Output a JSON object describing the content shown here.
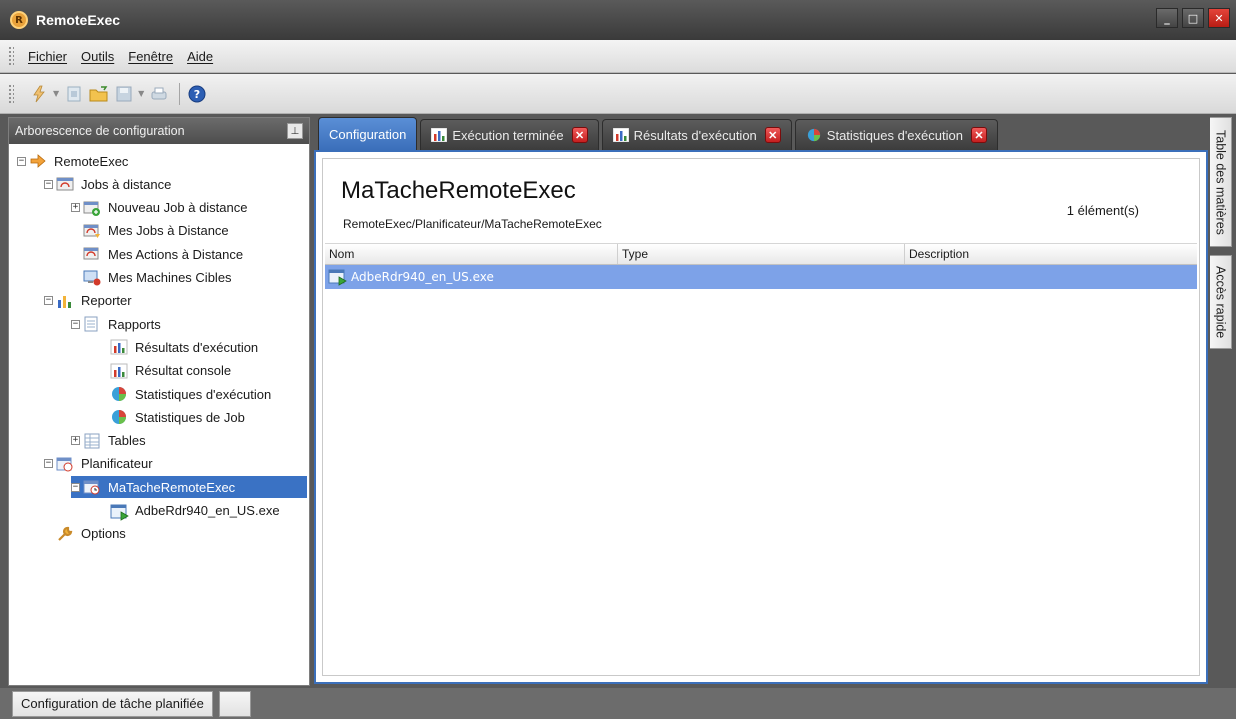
{
  "window": {
    "title": "RemoteExec"
  },
  "menu": [
    "Fichier",
    "Outils",
    "Fenêtre",
    "Aide"
  ],
  "toolbar": {
    "icons": [
      "run-icon",
      "new-icon",
      "open-folder-icon",
      "save-icon",
      "print-icon",
      "help-icon"
    ]
  },
  "left_panel": {
    "header": "Arborescence de configuration",
    "tree": [
      {
        "label": "RemoteExec",
        "icon": "remoteexec-icon",
        "level": 0,
        "expander": "−"
      },
      {
        "label": "Jobs à distance",
        "icon": "jobs-icon",
        "level": 1,
        "expander": "−"
      },
      {
        "label": "Nouveau Job à distance",
        "icon": "new-job-icon",
        "level": 2,
        "expander": "+"
      },
      {
        "label": "Mes Jobs à Distance",
        "icon": "my-jobs-icon",
        "level": 2,
        "expander": ""
      },
      {
        "label": "Mes Actions à Distance",
        "icon": "my-actions-icon",
        "level": 2,
        "expander": ""
      },
      {
        "label": "Mes Machines Cibles",
        "icon": "target-machines-icon",
        "level": 2,
        "expander": ""
      },
      {
        "label": "Reporter",
        "icon": "reporter-icon",
        "level": 1,
        "expander": "−"
      },
      {
        "label": "Rapports",
        "icon": "reports-icon",
        "level": 2,
        "expander": "−"
      },
      {
        "label": "Résultats d'exécution",
        "icon": "bar-chart-icon",
        "level": 3,
        "expander": ""
      },
      {
        "label": "Résultat console",
        "icon": "bar-chart-icon",
        "level": 3,
        "expander": ""
      },
      {
        "label": "Statistiques d'exécution",
        "icon": "pie-chart-icon",
        "level": 3,
        "expander": ""
      },
      {
        "label": "Statistiques de Job",
        "icon": "pie-chart-icon",
        "level": 3,
        "expander": ""
      },
      {
        "label": "Tables",
        "icon": "table-icon",
        "level": 2,
        "expander": "+"
      },
      {
        "label": "Planificateur",
        "icon": "scheduler-icon",
        "level": 1,
        "expander": "−"
      },
      {
        "label": "MaTacheRemoteExec",
        "icon": "scheduled-task-icon",
        "level": 2,
        "expander": "−",
        "selected": true
      },
      {
        "label": "AdbeRdr940_en_US.exe",
        "icon": "executable-icon",
        "level": 3,
        "expander": ""
      },
      {
        "label": "Options",
        "icon": "wrench-icon",
        "level": 1,
        "expander": ""
      }
    ]
  },
  "tabs": [
    {
      "label": "Configuration",
      "active": true,
      "icon": "",
      "closable": false
    },
    {
      "label": "Exécution terminée",
      "active": false,
      "icon": "bar-chart-icon",
      "closable": true
    },
    {
      "label": "Résultats d'exécution",
      "active": false,
      "icon": "bar-chart-icon",
      "closable": true
    },
    {
      "label": "Statistiques d'exécution",
      "active": false,
      "icon": "pie-chart-icon",
      "closable": true
    }
  ],
  "main": {
    "title": "MaTacheRemoteExec",
    "path": "RemoteExec/Planificateur/MaTacheRemoteExec",
    "count": "1 élément(s)",
    "columns": [
      "Nom",
      "Type",
      "Description"
    ],
    "rows": [
      {
        "name": "AdbeRdr940_en_US.exe",
        "type": "",
        "description": ""
      }
    ]
  },
  "side_tabs": [
    "Table des matières",
    "Accès rapide"
  ],
  "status": {
    "text": "Configuration de tâche planifiée"
  },
  "colors": {
    "accent": "#3b6fba",
    "selected_row": "#7da2e8",
    "chrome": "#4d4d4d"
  }
}
